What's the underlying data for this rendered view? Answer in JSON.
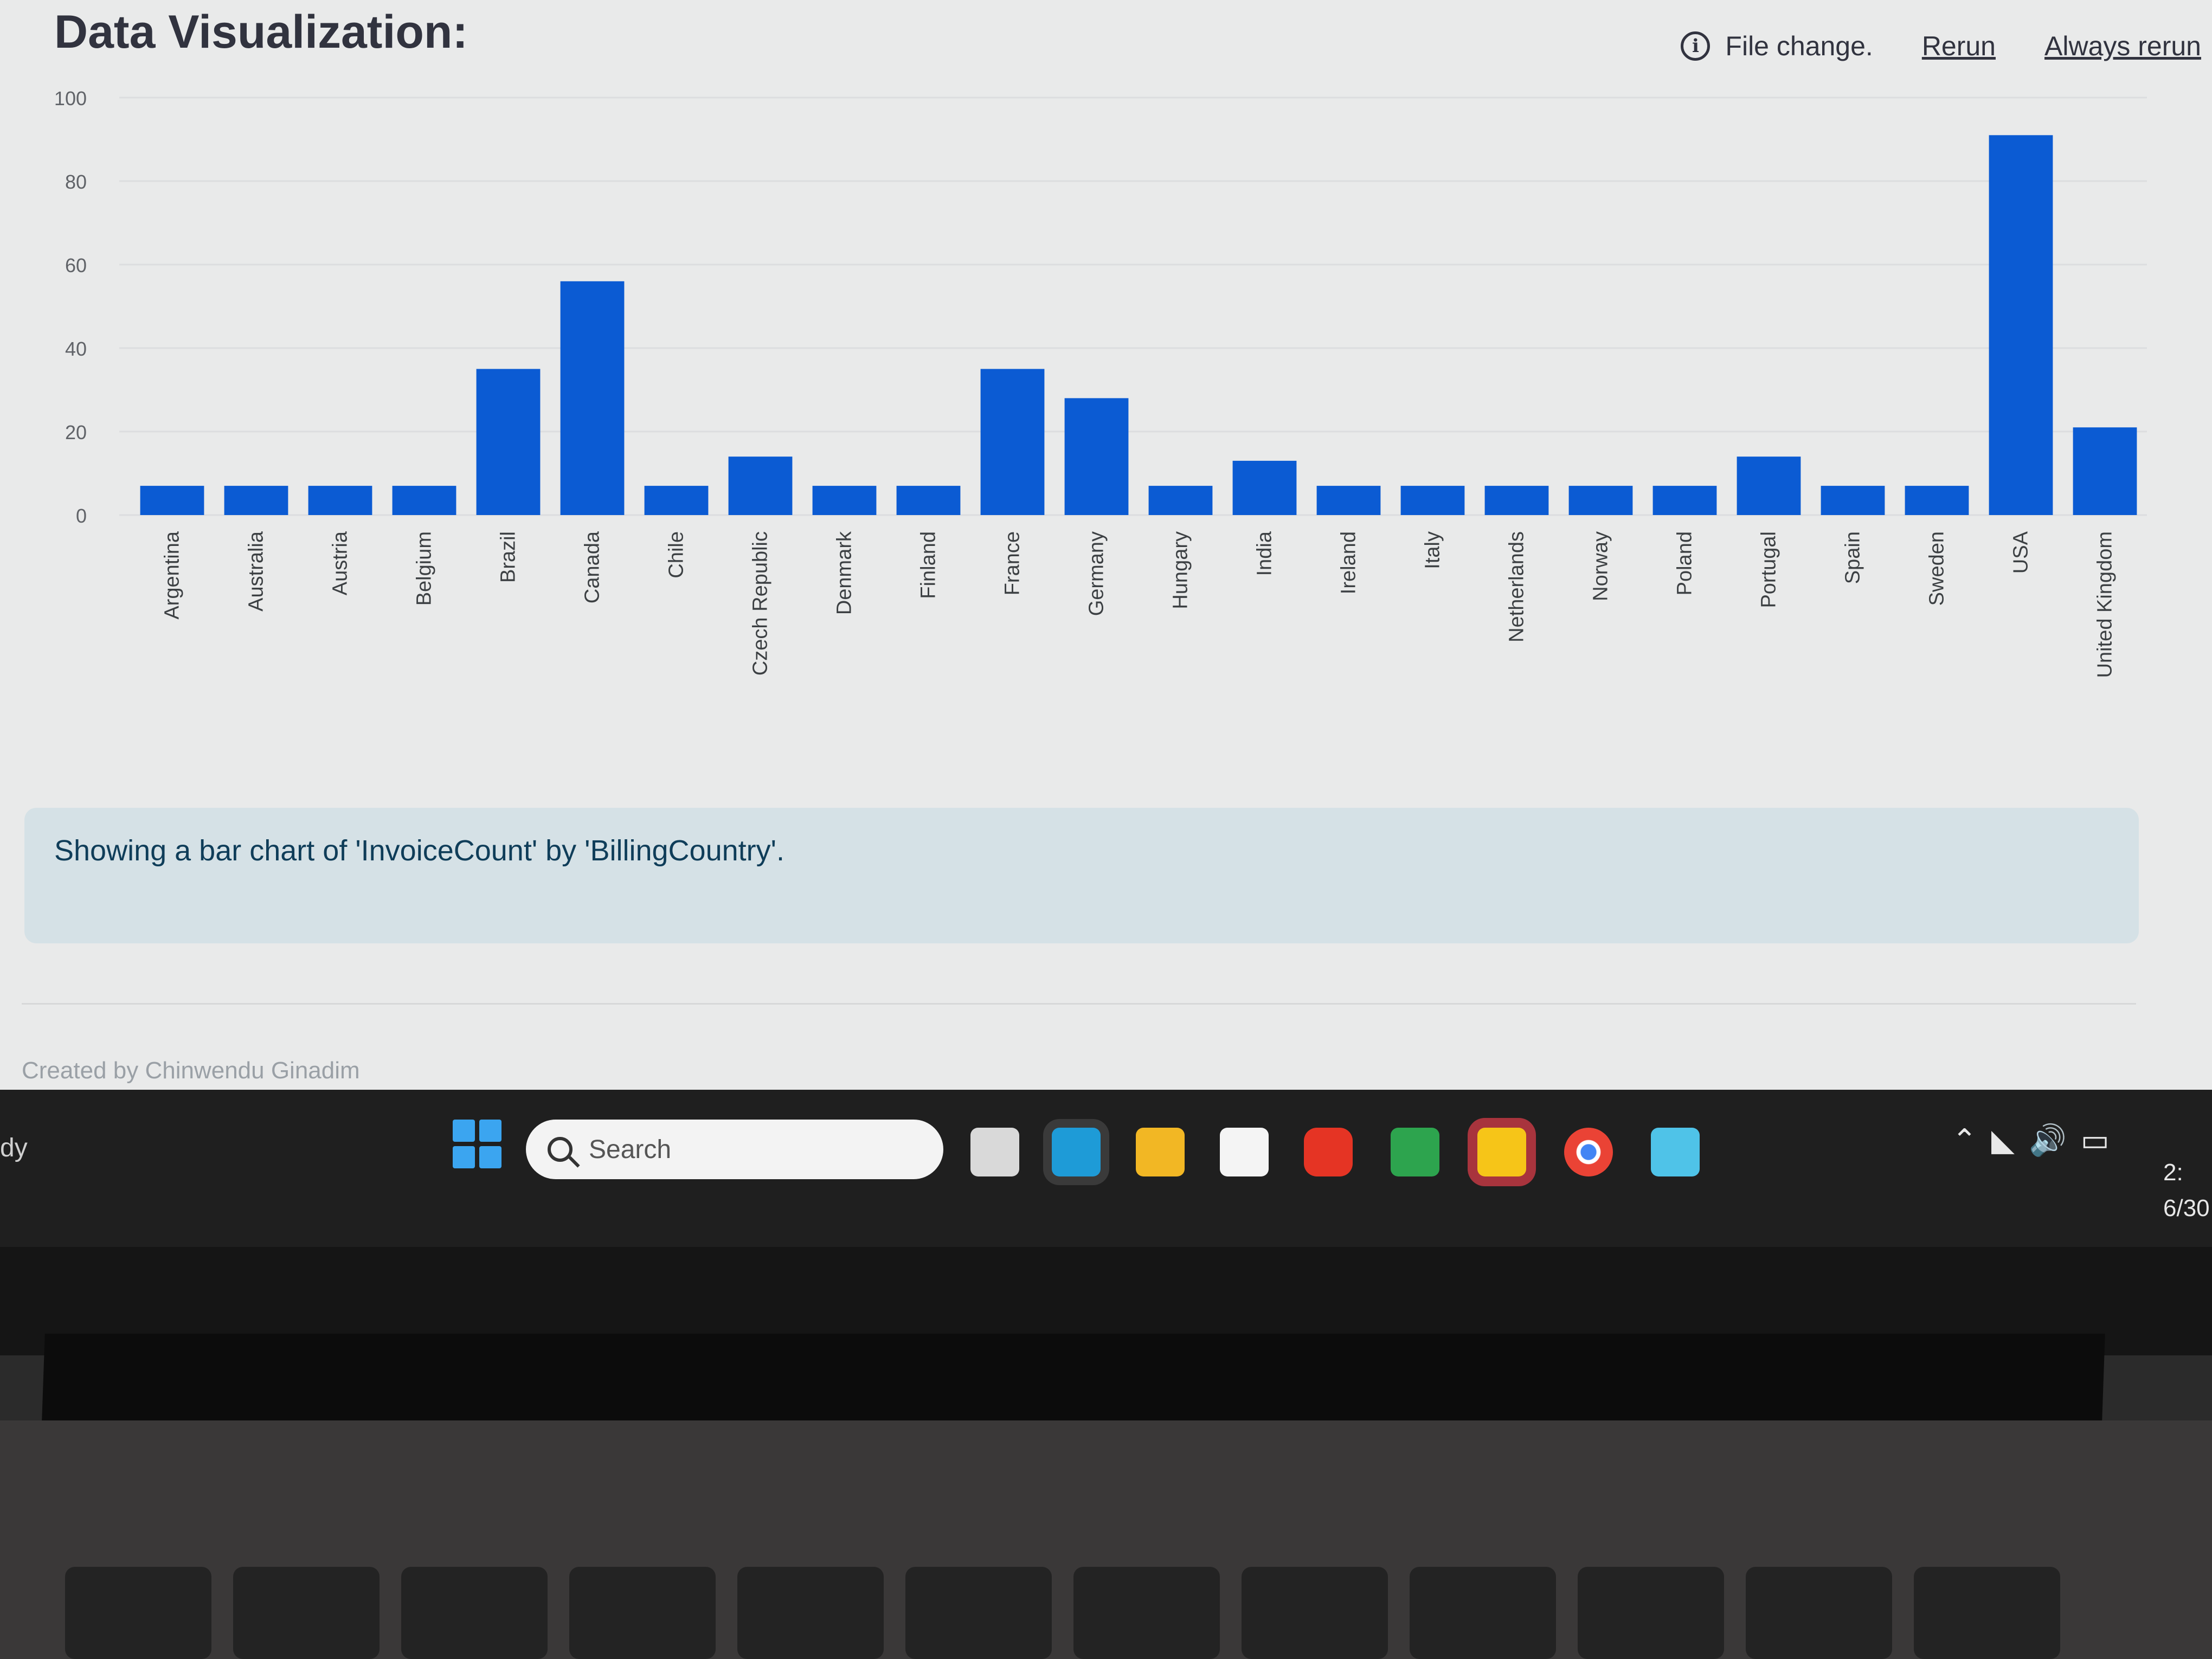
{
  "header": {
    "title": "Data Visualization:",
    "status_text": "File change.",
    "rerun_label": "Rerun",
    "always_rerun_label": "Always rerun"
  },
  "chart_data": {
    "type": "bar",
    "title": "",
    "xlabel": "",
    "ylabel": "",
    "ylim": [
      0,
      100
    ],
    "yticks": [
      0,
      20,
      40,
      60,
      80,
      100
    ],
    "bar_color": "#0b5bd3",
    "grid": true,
    "categories": [
      "Argentina",
      "Australia",
      "Austria",
      "Belgium",
      "Brazil",
      "Canada",
      "Chile",
      "Czech Republic",
      "Denmark",
      "Finland",
      "France",
      "Germany",
      "Hungary",
      "India",
      "Ireland",
      "Italy",
      "Netherlands",
      "Norway",
      "Poland",
      "Portugal",
      "Spain",
      "Sweden",
      "USA",
      "United Kingdom"
    ],
    "values": [
      7,
      7,
      7,
      7,
      35,
      56,
      7,
      14,
      7,
      7,
      35,
      28,
      7,
      13,
      7,
      7,
      7,
      7,
      7,
      14,
      7,
      7,
      91,
      21
    ]
  },
  "info_message": "Showing a bar chart of 'InvoiceCount' by 'BillingCountry'.",
  "footer": {
    "credit": "Created by Chinwendu Ginadim"
  },
  "taskbar": {
    "left_text": "dy",
    "search_placeholder": "Search",
    "clock_time": "2:",
    "clock_date": "6/30",
    "apps": [
      "task-view-icon",
      "edge-icon",
      "file-explorer-icon",
      "store-icon",
      "youtube-icon",
      "chat-icon",
      "sticky-notes-icon",
      "chrome-icon",
      "notepad-icon"
    ]
  }
}
